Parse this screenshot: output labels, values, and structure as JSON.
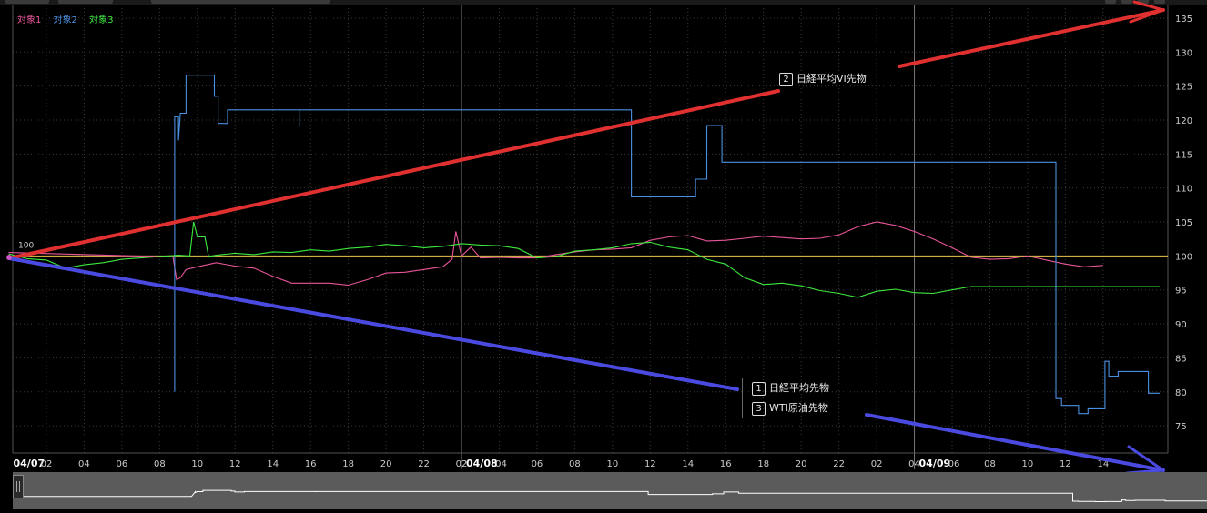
{
  "chart_data": {
    "type": "line",
    "y_axis": {
      "ticks": [
        135,
        130,
        125,
        120,
        115,
        110,
        105,
        100,
        95,
        90,
        85,
        80,
        75
      ],
      "range": [
        71,
        137
      ],
      "position": "right"
    },
    "x_axis": {
      "day_labels": [
        "04/07",
        "04/08",
        "04/09"
      ],
      "hour_labels": [
        "02",
        "04",
        "06",
        "08",
        "10",
        "12",
        "14",
        "16",
        "18",
        "20",
        "22",
        "02",
        "04",
        "06",
        "08",
        "10",
        "12",
        "14",
        "16",
        "18",
        "20",
        "22",
        "02",
        "04",
        "06",
        "08",
        "10",
        "12",
        "14"
      ],
      "hours_total": 58
    },
    "baseline_label": "100",
    "baseline_value": 100,
    "grid": true,
    "legend_position": "top-left",
    "series": [
      {
        "name": "対象1",
        "color": "#e8559a",
        "points": [
          [
            0,
            100.5
          ],
          [
            8,
            99.9
          ],
          [
            8.7,
            100
          ],
          [
            8.9,
            96.5
          ],
          [
            9.1,
            96.8
          ],
          [
            9.4,
            98
          ],
          [
            10,
            98.4
          ],
          [
            11,
            99
          ],
          [
            12,
            98.5
          ],
          [
            13,
            98.2
          ],
          [
            14,
            97
          ],
          [
            15,
            96
          ],
          [
            16,
            96
          ],
          [
            17,
            96
          ],
          [
            18,
            95.7
          ],
          [
            19,
            96.5
          ],
          [
            20,
            97.5
          ],
          [
            21,
            97.6
          ],
          [
            22,
            98
          ],
          [
            23,
            98.4
          ],
          [
            23.5,
            99.5
          ],
          [
            23.7,
            103.6
          ],
          [
            24,
            100
          ],
          [
            24.5,
            101.3
          ],
          [
            25,
            99.7
          ],
          [
            26,
            99.8
          ],
          [
            27,
            99.7
          ],
          [
            28,
            99.7
          ],
          [
            29,
            100.2
          ],
          [
            30,
            100.6
          ],
          [
            31,
            100.9
          ],
          [
            32,
            101
          ],
          [
            33,
            101.2
          ],
          [
            34,
            102.3
          ],
          [
            35,
            102.8
          ],
          [
            36,
            103
          ],
          [
            37,
            102.2
          ],
          [
            38,
            102.3
          ],
          [
            39,
            102.6
          ],
          [
            40,
            102.9
          ],
          [
            41,
            102.7
          ],
          [
            42,
            102.5
          ],
          [
            43,
            102.6
          ],
          [
            44,
            103.1
          ],
          [
            45,
            104.3
          ],
          [
            46,
            105
          ],
          [
            47,
            104.5
          ],
          [
            48,
            103.6
          ],
          [
            49,
            102.5
          ],
          [
            50,
            101.2
          ],
          [
            51,
            99.8
          ],
          [
            52,
            99.5
          ],
          [
            53,
            99.6
          ],
          [
            54,
            100
          ],
          [
            55,
            99.4
          ],
          [
            56,
            98.8
          ],
          [
            57,
            98.4
          ],
          [
            58,
            98.6
          ]
        ]
      },
      {
        "name": "対象2",
        "color": "#4a90e2",
        "points": [
          [
            8.8,
            80
          ],
          [
            8.8,
            120.5
          ],
          [
            9,
            120.5
          ],
          [
            9,
            117
          ],
          [
            9.1,
            121
          ],
          [
            9.4,
            121
          ],
          [
            9.4,
            126.6
          ],
          [
            10.9,
            126.6
          ],
          [
            10.9,
            123.5
          ],
          [
            11.1,
            123.5
          ],
          [
            11.1,
            119.5
          ],
          [
            11.6,
            119.5
          ],
          [
            11.6,
            121.5
          ],
          [
            15.4,
            121.5
          ],
          [
            15.4,
            119
          ],
          [
            15.4,
            121.5
          ],
          [
            33,
            121.5
          ],
          [
            33,
            108.7
          ],
          [
            36.4,
            108.7
          ],
          [
            36.4,
            111.3
          ],
          [
            37,
            111.3
          ],
          [
            37,
            119.2
          ],
          [
            37.8,
            119.2
          ],
          [
            37.8,
            113.8
          ],
          [
            55.5,
            113.8
          ],
          [
            55.5,
            79
          ],
          [
            55.8,
            79
          ],
          [
            55.8,
            78
          ],
          [
            56.7,
            78
          ],
          [
            56.7,
            76.8
          ],
          [
            57.2,
            76.8
          ],
          [
            57.2,
            77.5
          ],
          [
            58.1,
            77.5
          ],
          [
            58.1,
            84.5
          ],
          [
            58.3,
            84.5
          ],
          [
            58.3,
            82.3
          ],
          [
            58.8,
            82.3
          ],
          [
            58.8,
            83
          ],
          [
            60.4,
            83
          ],
          [
            60.4,
            79.8
          ],
          [
            61,
            79.8
          ]
        ]
      },
      {
        "name": "対象3",
        "color": "#3ee83e",
        "points": [
          [
            0,
            100.3
          ],
          [
            1,
            99.6
          ],
          [
            2,
            99.4
          ],
          [
            3,
            98.2
          ],
          [
            4,
            98.7
          ],
          [
            5,
            99
          ],
          [
            6,
            99.5
          ],
          [
            7,
            99.7
          ],
          [
            8,
            99.9
          ],
          [
            9,
            100.1
          ],
          [
            9.6,
            100
          ],
          [
            9.8,
            105
          ],
          [
            10,
            102.8
          ],
          [
            10.4,
            102.8
          ],
          [
            10.6,
            99.9
          ],
          [
            11,
            100.1
          ],
          [
            12,
            100.4
          ],
          [
            13,
            100.2
          ],
          [
            14,
            100.6
          ],
          [
            15,
            100.5
          ],
          [
            16,
            100.9
          ],
          [
            17,
            100.7
          ],
          [
            18,
            101.1
          ],
          [
            19,
            101.3
          ],
          [
            20,
            101.7
          ],
          [
            21,
            101.5
          ],
          [
            22,
            101.2
          ],
          [
            23,
            101.4
          ],
          [
            24,
            101.8
          ],
          [
            25,
            101.6
          ],
          [
            26,
            101.5
          ],
          [
            27,
            101.1
          ],
          [
            28,
            99.7
          ],
          [
            29,
            99.9
          ],
          [
            30,
            100.7
          ],
          [
            31,
            100.9
          ],
          [
            32,
            101.2
          ],
          [
            33,
            101.8
          ],
          [
            34,
            102
          ],
          [
            35,
            101.3
          ],
          [
            36,
            100.9
          ],
          [
            37,
            99.5
          ],
          [
            38,
            98.8
          ],
          [
            39,
            96.8
          ],
          [
            40,
            95.8
          ],
          [
            41,
            96
          ],
          [
            42,
            95.6
          ],
          [
            43,
            94.9
          ],
          [
            44,
            94.5
          ],
          [
            45,
            93.9
          ],
          [
            46,
            94.8
          ],
          [
            47,
            95.1
          ],
          [
            48,
            94.6
          ],
          [
            49,
            94.5
          ],
          [
            50,
            95
          ],
          [
            51,
            95.5
          ],
          [
            51.6,
            95.5
          ],
          [
            61,
            95.5
          ]
        ]
      }
    ]
  },
  "annotations": [
    {
      "num": "2",
      "label": "日経平均VI先物"
    },
    {
      "num": "1",
      "label": "日経平均先物"
    },
    {
      "num": "3",
      "label": "WTI原油先物"
    }
  ],
  "colors": {
    "red_arrow": "#e03030",
    "blue_arrow": "#4a4ae0",
    "baseline": "#e8c44a",
    "grid": "#3a3a3a"
  }
}
